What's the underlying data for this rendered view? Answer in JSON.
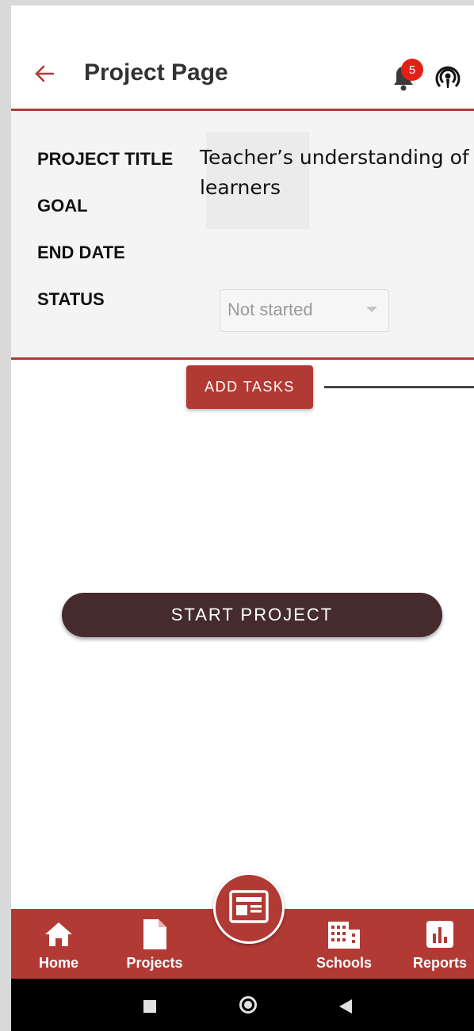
{
  "header": {
    "title": "Project Page",
    "notification_count": "5",
    "accent_color": "#b23a35"
  },
  "project": {
    "labels": {
      "title": "PROJECT TITLE",
      "goal": "GOAL",
      "end_date": "END DATE",
      "status": "STATUS"
    },
    "title_value": "Teacher’s understanding of learners",
    "status_value": "Not started"
  },
  "actions": {
    "add_tasks": "ADD TASKS",
    "start_project": "START PROJECT"
  },
  "bottom_nav": {
    "items": [
      {
        "label": "Home",
        "icon": "home-icon"
      },
      {
        "label": "Projects",
        "icon": "document-icon"
      },
      {
        "label": "Schools",
        "icon": "building-icon"
      },
      {
        "label": "Reports",
        "icon": "bar-chart-icon"
      }
    ],
    "fab_icon": "newspaper-icon"
  },
  "system_bar": {
    "icons": [
      "recents-square-icon",
      "home-circle-icon",
      "back-triangle-icon"
    ]
  }
}
